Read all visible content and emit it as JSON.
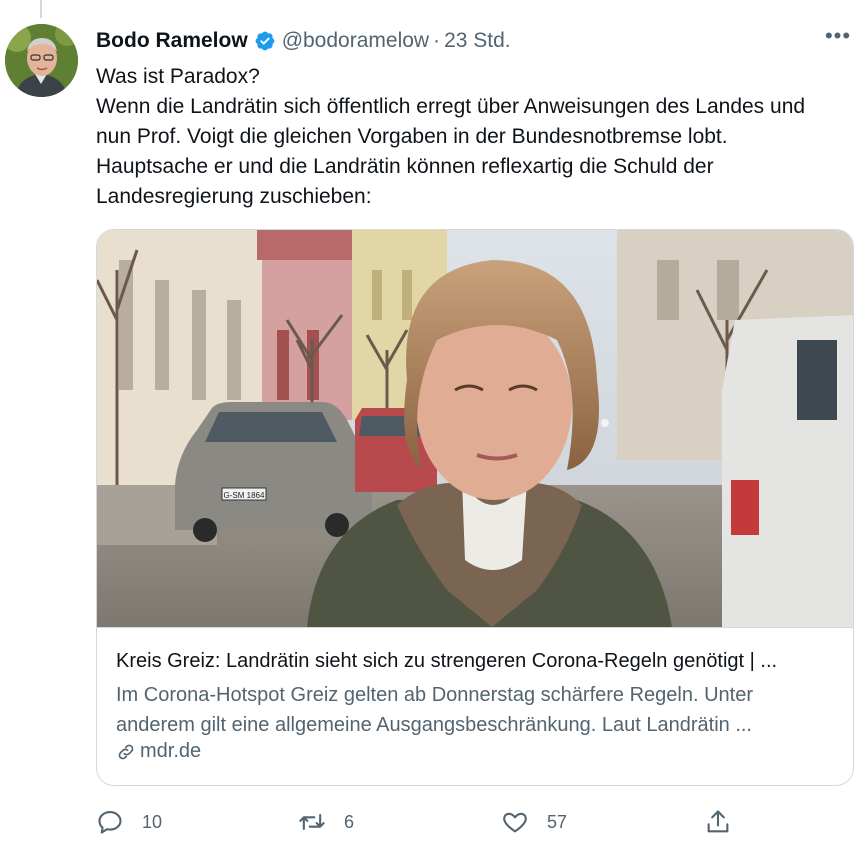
{
  "tweet": {
    "author_name": "Bodo Ramelow",
    "handle": "@bodoramelow",
    "separator": "·",
    "time": "23 Std.",
    "more": "•••",
    "text_lines": [
      "Was ist Paradox?",
      "Wenn die Landrätin sich öffentlich erregt über Anweisungen des Landes und",
      "nun Prof. Voigt die gleichen Vorgaben in der Bundesnotbremse lobt.",
      "Hauptsache er und die Landrätin können reflexartig die Schuld der",
      "Landesregierung zuschieben:"
    ]
  },
  "card": {
    "title": "Kreis Greiz: Landrätin sieht sich zu strengeren Corona-Regeln genötigt | ...",
    "description_lines": [
      "Im Corona-Hotspot Greiz gelten ab Donnerstag schärfere Regeln. Unter",
      "anderem gilt eine allgemeine Ausgangsbeschränkung. Laut Landrätin ..."
    ],
    "domain": "mdr.de",
    "car_plate": "G-SM 1864"
  },
  "actions": {
    "reply_count": "10",
    "retweet_count": "6",
    "like_count": "57"
  },
  "colors": {
    "text": "#0f1419",
    "secondary": "#536471",
    "border": "#cfd9de",
    "verified": "#1d9bf0"
  }
}
